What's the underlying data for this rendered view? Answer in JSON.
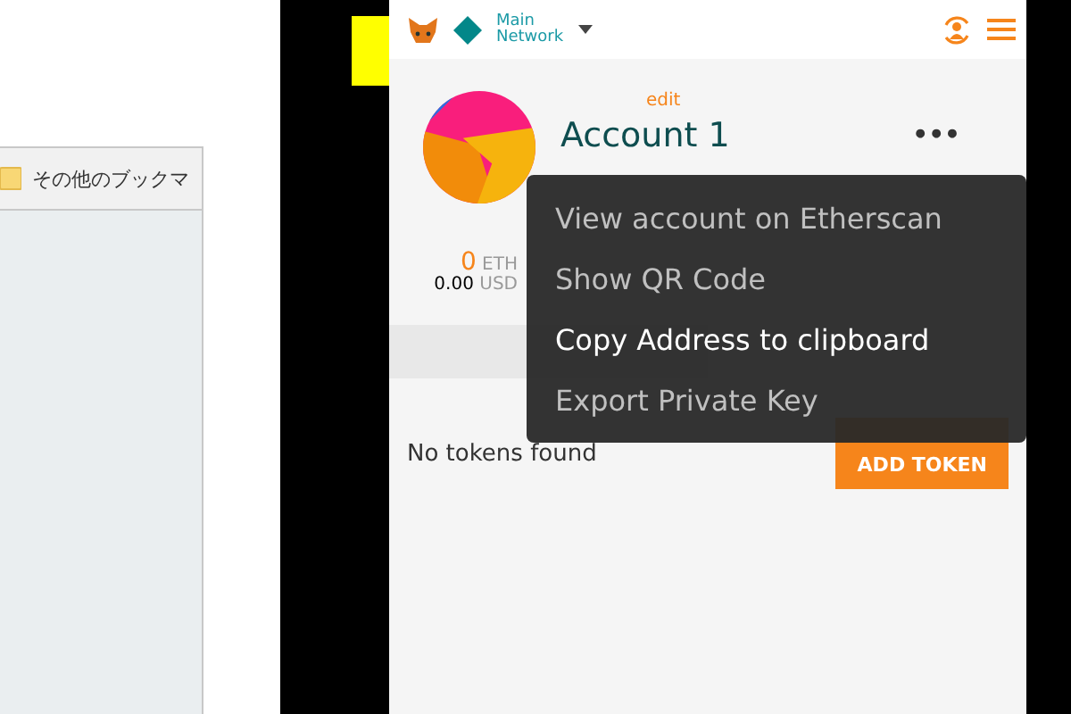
{
  "bookmarks_bar": {
    "folder_label": "その他のブックマ"
  },
  "header": {
    "network_line1": "Main",
    "network_line2": "Network"
  },
  "account": {
    "edit_label": "edit",
    "name": "Account 1",
    "more": "•••"
  },
  "balance": {
    "amount": "0",
    "unit": "ETH",
    "fiat_amount": "0.00",
    "fiat_unit": "USD"
  },
  "tokens": {
    "empty_message": "No tokens found",
    "add_button": "ADD TOKEN"
  },
  "menu": [
    {
      "label": "View account on Etherscan",
      "selected": false
    },
    {
      "label": "Show QR Code",
      "selected": false
    },
    {
      "label": "Copy Address to clipboard",
      "selected": true
    },
    {
      "label": "Export Private Key",
      "selected": false
    }
  ]
}
